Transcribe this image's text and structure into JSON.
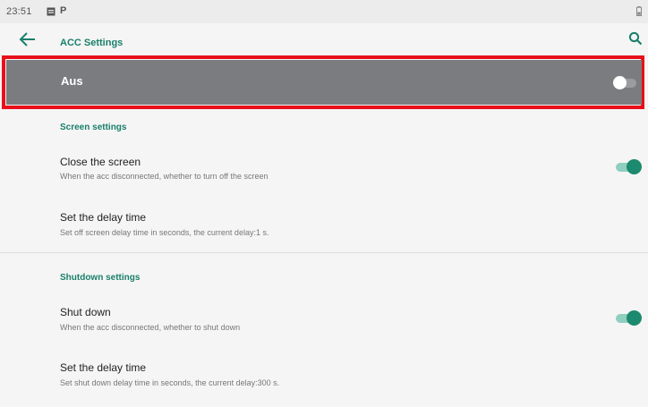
{
  "status_bar": {
    "time": "23:51",
    "notif_icons": [
      "image-icon",
      "parking-icon"
    ],
    "p_glyph": "P",
    "battery_icon": "battery-icon"
  },
  "app_bar": {
    "back_icon": "back-arrow-icon",
    "title": "ACC Settings",
    "search_icon": "search-icon"
  },
  "master_switch": {
    "label": "Aus",
    "state": "off"
  },
  "sections": [
    {
      "header": "Screen settings",
      "items": [
        {
          "title": "Close the screen",
          "summary": "When the acc disconnected, whether to turn off the screen",
          "switch": "on"
        },
        {
          "title": "Set the delay time",
          "summary": "Set off screen delay time in seconds, the current delay:1 s."
        }
      ]
    },
    {
      "header": "Shutdown settings",
      "items": [
        {
          "title": "Shut down",
          "summary": "When the acc disconnected, whether to shut down",
          "switch": "on"
        },
        {
          "title": "Set the delay time",
          "summary": "Set shut down delay time in seconds, the current delay:300 s."
        }
      ]
    }
  ],
  "colors": {
    "accent": "#1a7f6b",
    "switch_on_thumb": "#1c8a6e",
    "master_bg": "#7a7c80",
    "highlight_border": "#e8101a"
  }
}
